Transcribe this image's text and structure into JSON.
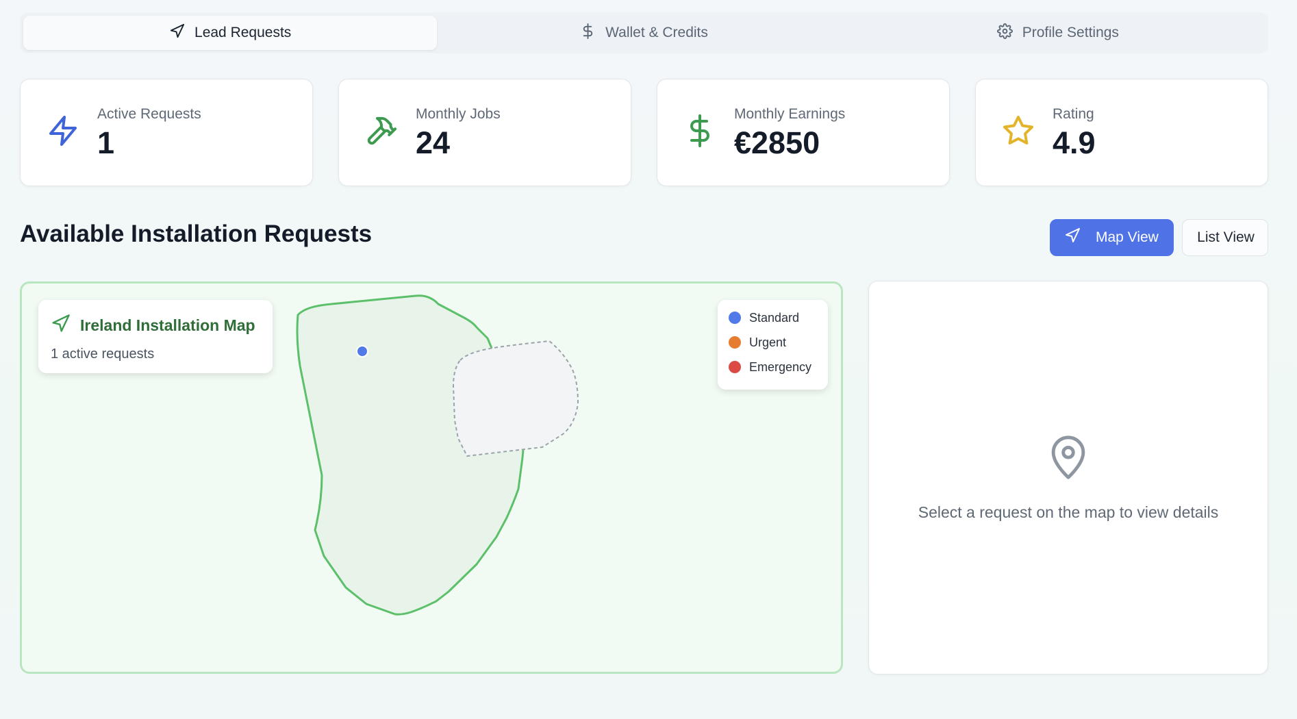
{
  "tabs": [
    {
      "label": "Lead Requests",
      "icon": "navigation-icon",
      "active": true
    },
    {
      "label": "Wallet & Credits",
      "icon": "dollar-icon",
      "active": false
    },
    {
      "label": "Profile Settings",
      "icon": "gear-icon",
      "active": false
    }
  ],
  "stats": [
    {
      "label": "Active Requests",
      "value": "1",
      "icon": "lightning-icon",
      "color": "#3f63d8"
    },
    {
      "label": "Monthly Jobs",
      "value": "24",
      "icon": "hammer-icon",
      "color": "#3d9b50"
    },
    {
      "label": "Monthly Earnings",
      "value": "€2850",
      "icon": "dollar-icon",
      "color": "#3d9b50"
    },
    {
      "label": "Rating",
      "value": "4.9",
      "icon": "star-icon",
      "color": "#e3b42a"
    }
  ],
  "section": {
    "title": "Available Installation Requests",
    "map_view_label": "Map View",
    "list_view_label": "List View"
  },
  "map": {
    "title": "Ireland Installation Map",
    "subtitle": "1 active requests",
    "legend": [
      {
        "label": "Standard",
        "color": "#4f7ae8"
      },
      {
        "label": "Urgent",
        "color": "#e57c30"
      },
      {
        "label": "Emergency",
        "color": "#dc4b43"
      }
    ],
    "markers": [
      {
        "type": "Standard"
      }
    ]
  },
  "details": {
    "hint": "Select a request on the map to view details"
  },
  "colors": {
    "primary": "#4f73e6",
    "success": "#3d9b50",
    "map_fill": "#e8f4e9",
    "map_border": "#5cbf6a"
  }
}
